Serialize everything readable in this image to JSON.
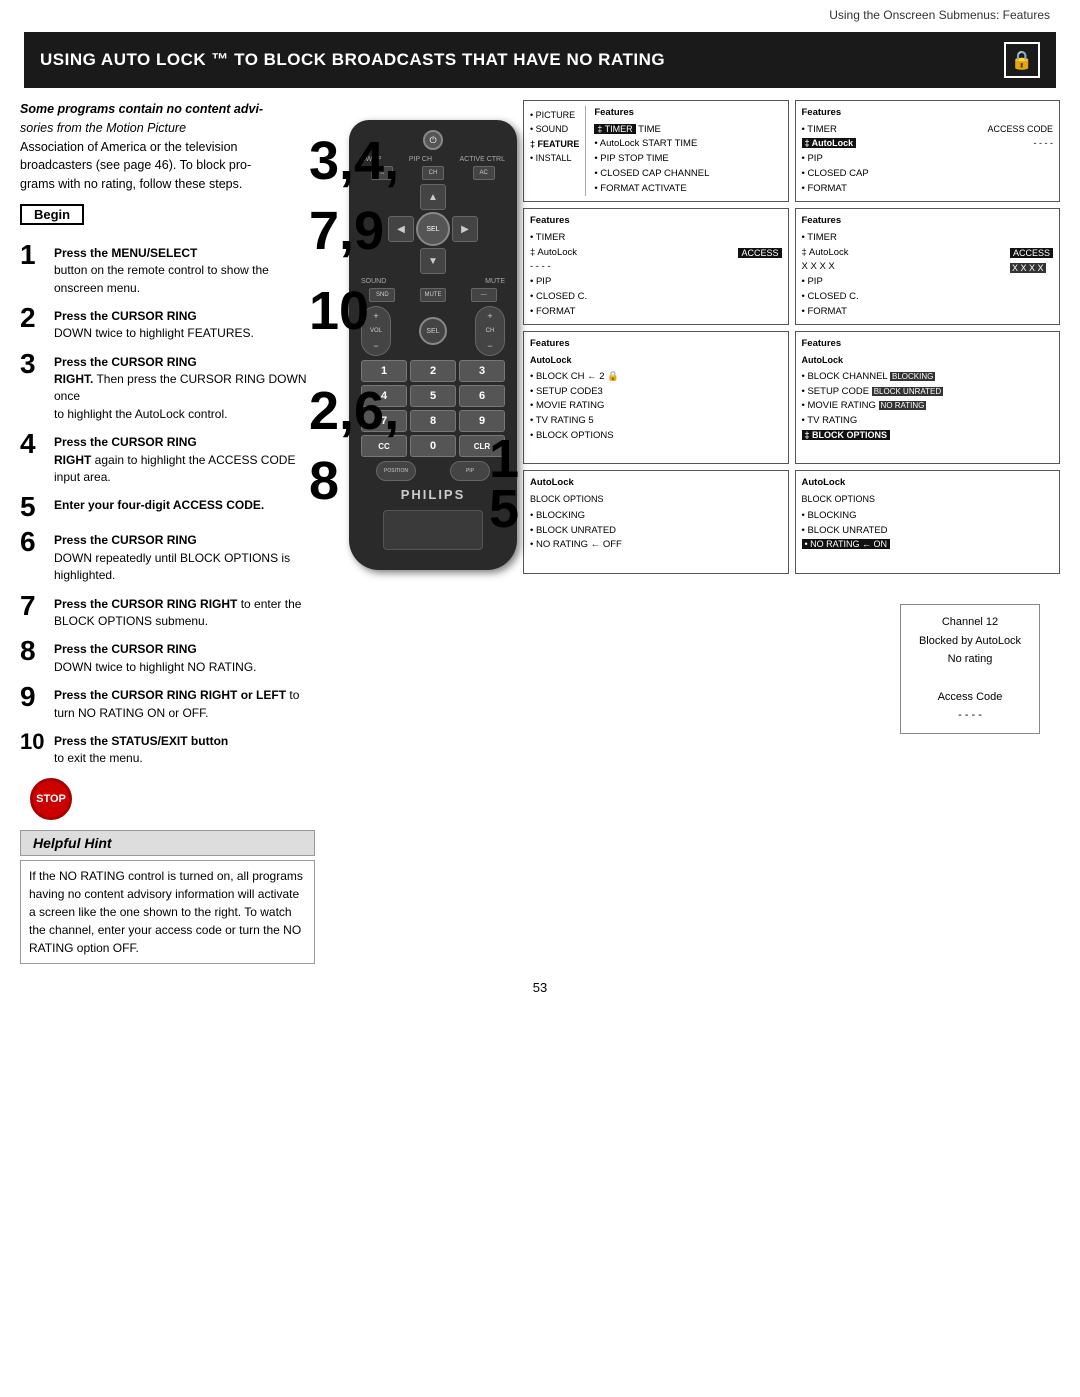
{
  "header": {
    "text": "Using the Onscreen Submenus: Features"
  },
  "title": {
    "main": "Using Auto Lock ™ to Block Broadcasts That Have No Rating",
    "lock_icon": "🔒"
  },
  "intro": {
    "line1": "Some programs contain no content advi-",
    "line2": "sories from the Motion Picture",
    "line3": "Association of America or the television",
    "line4": "broadcasters (see page 46). To block pro-",
    "line5": "grams with no rating, follow these steps."
  },
  "begin_label": "Begin",
  "steps": [
    {
      "num": "1",
      "text_bold": "Press the MENU/SELECT",
      "text_normal": " button on the remote control to show the onscreen menu."
    },
    {
      "num": "2",
      "text_bold": "Press the CURSOR RING",
      "text_normal": " DOWN twice to highlight FEATURES."
    },
    {
      "num": "3",
      "text_bold": "Press the CURSOR RING RIGHT.",
      "text_normal": " Then press the CURSOR RING DOWN once to highlight the AutoLock control."
    },
    {
      "num": "4",
      "text_bold": "Press the CURSOR RING RIGHT",
      "text_normal": " again to highlight the ACCESS CODE input area."
    },
    {
      "num": "5",
      "text_bold": "Enter your four-digit ACCESS CODE."
    },
    {
      "num": "6",
      "text_bold": "Press the CURSOR RING",
      "text_normal": " DOWN repeatedly until BLOCK OPTIONS is highlighted."
    },
    {
      "num": "7",
      "text_bold": "Press the CURSOR RING RIGHT",
      "text_normal": " to enter the BLOCK OPTIONS submenu."
    },
    {
      "num": "8",
      "text_bold": "Press the CURSOR RING",
      "text_normal": " DOWN twice to highlight NO RATING."
    },
    {
      "num": "9",
      "text_bold": "Press the CURSOR RING RIGHT or LEFT",
      "text_normal": " to turn NO RATING ON or OFF."
    },
    {
      "num": "10",
      "text_bold": "Press the STATUS/EXIT button",
      "text_normal": " to exit the menu."
    }
  ],
  "screens": {
    "s1_title": "Features",
    "s1_items": [
      {
        "bullet": "•",
        "text": "TIMER",
        "highlight": "",
        "extra": "TIME"
      },
      {
        "bullet": "•",
        "text": "AutoLock",
        "highlight": "",
        "extra": "START TIME"
      },
      {
        "bullet": "•",
        "text": "PIP",
        "highlight": "",
        "extra": "STOP TIME"
      },
      {
        "bullet": "•",
        "text": "CLOSED CAP",
        "highlight": "",
        "extra": "CHANNEL"
      },
      {
        "bullet": "•",
        "text": "FORMAT",
        "highlight": "",
        "extra": "ACTIVATE"
      }
    ],
    "s1_left_items": [
      {
        "text": "• PICTURE",
        "sub": "TIMER"
      },
      {
        "text": "• SOUND",
        "sub": "AutoLock"
      },
      {
        "text": "‡ FEATURE",
        "sub": "PIP",
        "bold": true
      },
      {
        "text": "• INSTALL",
        "sub": "CLOSED CAP"
      },
      {
        "text": "",
        "sub": "FORMAT"
      }
    ],
    "s2_title": "Features",
    "s2_items": [
      {
        "text": "• TIMER",
        "extra": "ACCESS CODE"
      },
      {
        "text": "‡ AutoLock",
        "extra": "- - - -",
        "highlight": true
      },
      {
        "text": "• PIP"
      },
      {
        "text": "• CLOSED CAP"
      },
      {
        "text": "• FORMAT"
      }
    ],
    "s3_title": "Features",
    "s3_items_left": [
      {
        "text": "• TIMER"
      },
      {
        "text": "‡ AutoLock"
      },
      {
        "text": "• PIP"
      },
      {
        "text": "• CLOSED C."
      },
      {
        "text": "• FORMAT"
      }
    ],
    "s3_right": "ACCESS",
    "s4_title": "Features",
    "s4_items": [
      {
        "text": "• TIMER"
      },
      {
        "text": "‡ AutoLock"
      },
      {
        "text": "• PIP"
      },
      {
        "text": "• CLOSED C."
      },
      {
        "text": "• FORMAT"
      }
    ],
    "s4_right": "ACCESS\nX X X X",
    "s5_title": "AutoLock",
    "s5_items": [
      {
        "text": "• BLOCK CH ← 2 🔒"
      },
      {
        "text": "• SETUP CODE3"
      },
      {
        "text": "• MOVIE RATING"
      },
      {
        "text": "• TV RATING   5"
      },
      {
        "text": "• BLOCK OPTIONS"
      }
    ],
    "s6_title": "AutoLock",
    "s6_items": [
      {
        "text": "• BLOCK CHANNEL",
        "hl": "BLOCKING"
      },
      {
        "text": "• SETUP CODE",
        "hl2": "BLOCK UNRATED"
      },
      {
        "text": "• MOVIE RATING",
        "hl2": "NO RATING"
      },
      {
        "text": "• TV RATING"
      },
      {
        "text": "‡ BLOCK OPTIONS",
        "bold": true
      }
    ],
    "s7_title": "AutoLock",
    "s7_sub": "BLOCK OPTIONS",
    "s7_items": [
      {
        "text": "• BLOCKING"
      },
      {
        "text": "• BLOCK UNRATED"
      },
      {
        "text": "• NO RATING ← OFF"
      }
    ],
    "s8_title": "AutoLock",
    "s8_sub": "BLOCK OPTIONS",
    "s8_items": [
      {
        "text": "• BLOCKING"
      },
      {
        "text": "• BLOCK UNRATED"
      },
      {
        "text": "• NO RATING ← ON",
        "highlight": true
      }
    ]
  },
  "hint": {
    "title": "Helpful Hint",
    "body": "If the NO RATING control is turned on, all programs having no content advisory information will activate a screen like the one shown to the right. To watch the channel, enter your access code or turn the NO RATING option OFF."
  },
  "hint_screen": {
    "line1": "Channel 12",
    "line2": "Blocked by AutoLock",
    "line3": "No rating",
    "line4": "",
    "line5": "Access Code",
    "line6": "- - - -"
  },
  "page_number": "53",
  "remote": {
    "brand": "PHILIPS"
  }
}
